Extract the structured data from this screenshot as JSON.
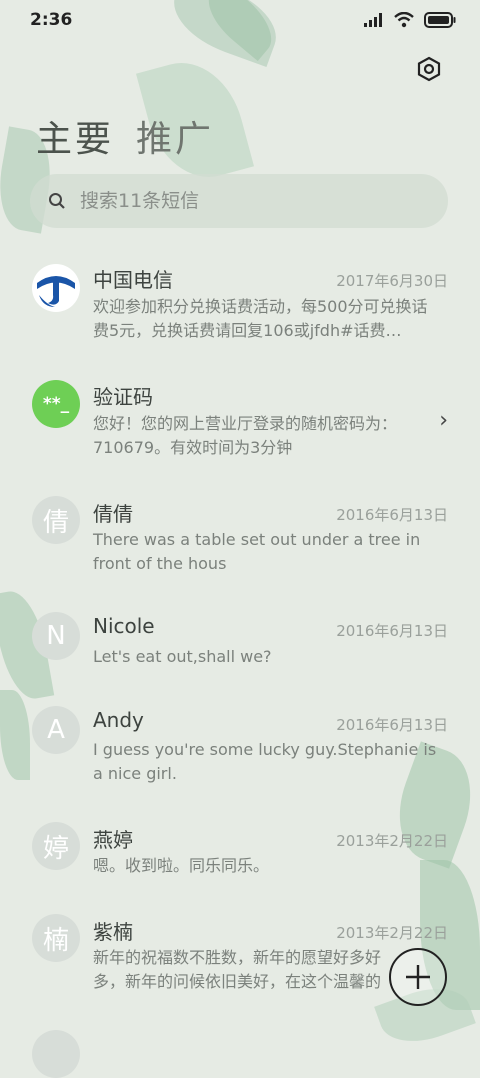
{
  "status": {
    "time": "2:36"
  },
  "tabs": [
    {
      "label": "主要"
    },
    {
      "label": "推广"
    }
  ],
  "search": {
    "placeholder": "搜索11条短信"
  },
  "messages": [
    {
      "name": "中国电信",
      "date": "2017年6月30日",
      "preview": "欢迎参加积分兑换话费活动，每500分可兑换话费5元，兑换话费请回复106或jfdh#话费…"
    },
    {
      "name": "验证码",
      "avatar": "**_",
      "preview": "您好！您的网上营业厅登录的随机密码为：710679。有效时间为3分钟"
    },
    {
      "name": "倩倩",
      "avatar": "倩",
      "date": "2016年6月13日",
      "preview": "There was a table set out under a tree in front of the hous"
    },
    {
      "name": "Nicole",
      "avatar": "N",
      "date": "2016年6月13日",
      "preview": "Let's eat out,shall we?"
    },
    {
      "name": "Andy",
      "avatar": "A",
      "date": "2016年6月13日",
      "preview": "I guess you're some lucky guy.Stephanie is a nice girl."
    },
    {
      "name": "燕婷",
      "avatar": "婷",
      "date": "2013年2月22日",
      "preview": "嗯。收到啦。同乐同乐。"
    },
    {
      "name": "紫楠",
      "avatar": "楠",
      "date": "2013年2月22日",
      "preview": "新年的祝福数不胜数，新年的愿望好多好多，新年的问候依旧美好，在这个温馨的时"
    }
  ],
  "colors": {
    "background": "#e6ebe4",
    "verify_avatar": "#6ecf55",
    "telecom_blue": "#1a55a8"
  }
}
